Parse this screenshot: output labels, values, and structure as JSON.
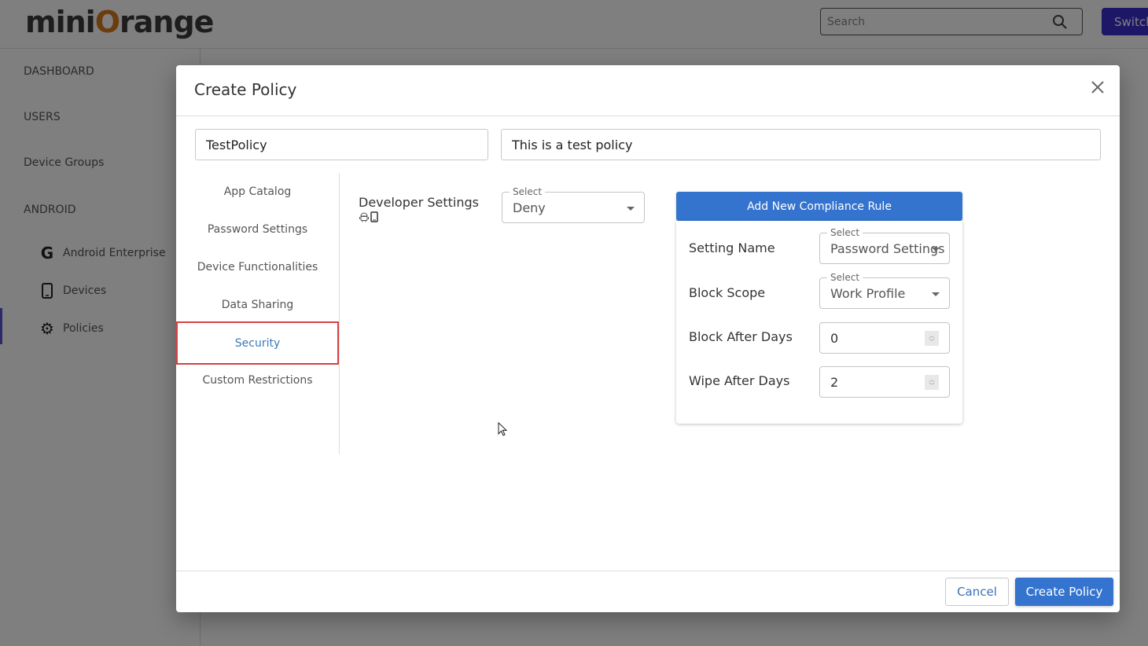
{
  "app": {
    "logo_text_pre": "mini",
    "logo_text_o": "O",
    "logo_text_post": "range",
    "search_placeholder": "Search",
    "switch_label": "Switch"
  },
  "sidebar": {
    "items": [
      {
        "label": "DASHBOARD"
      },
      {
        "label": "USERS"
      },
      {
        "label": "Device Groups"
      },
      {
        "label": "ANDROID"
      }
    ],
    "sub_items": [
      {
        "label": "Android Enterprise",
        "icon": "google-icon"
      },
      {
        "label": "Devices",
        "icon": "phone-icon"
      },
      {
        "label": "Policies",
        "icon": "gear-icon"
      }
    ]
  },
  "modal": {
    "title": "Create Policy",
    "policy_name": "TestPolicy",
    "policy_description": "This is a test policy",
    "tabs": [
      {
        "label": "App Catalog",
        "active": false
      },
      {
        "label": "Password Settings",
        "active": false
      },
      {
        "label": "Device Functionalities",
        "active": false
      },
      {
        "label": "Data Sharing",
        "active": false
      },
      {
        "label": "Security",
        "active": true
      },
      {
        "label": "Custom Restrictions",
        "active": false
      }
    ],
    "developer_settings": {
      "label": "Developer Settings",
      "select_legend": "Select",
      "value": "Deny"
    },
    "compliance": {
      "add_button": "Add New Compliance Rule",
      "setting_name_label": "Setting Name",
      "setting_name_legend": "Select",
      "setting_name_value": "Password Settings",
      "block_scope_label": "Block Scope",
      "block_scope_legend": "Select",
      "block_scope_value": "Work Profile",
      "block_after_days_label": "Block After Days",
      "block_after_days_value": "0",
      "wipe_after_days_label": "Wipe After Days",
      "wipe_after_days_value": "2"
    },
    "footer": {
      "cancel_label": "Cancel",
      "create_label": "Create Policy"
    }
  },
  "colors": {
    "primary": "#3474cf",
    "switch_button": "#3a2fcf",
    "active_tab_text": "#3a7ab8",
    "active_tab_border": "#d94040",
    "logo_orange": "#d77a1c"
  }
}
